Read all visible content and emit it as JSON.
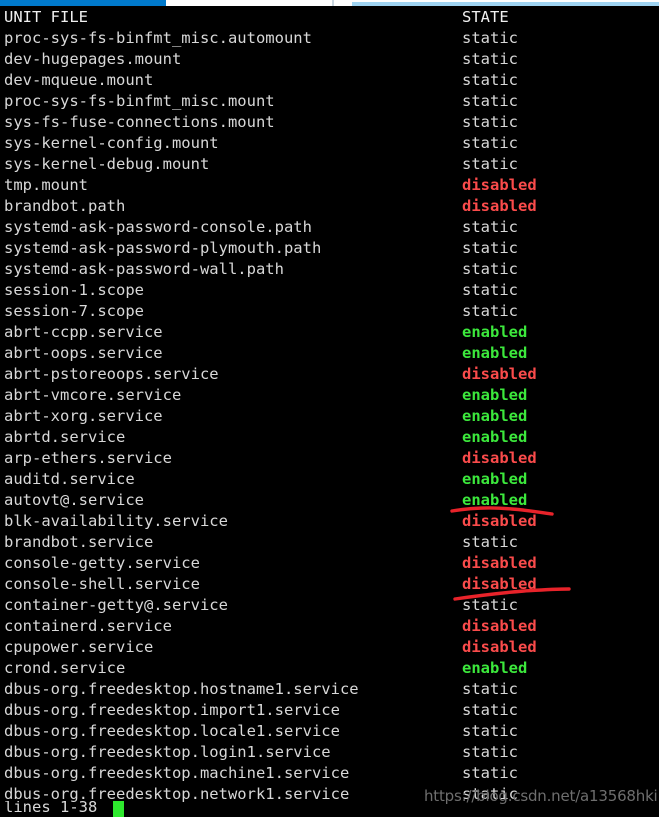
{
  "window": {
    "chrome_note": "partial browser/terminal tab strip"
  },
  "pager": {
    "columns": {
      "unit_file": "UNIT FILE",
      "state": "STATE"
    },
    "rows": [
      {
        "unit": "proc-sys-fs-binfmt_misc.automount",
        "state": "static"
      },
      {
        "unit": "dev-hugepages.mount",
        "state": "static"
      },
      {
        "unit": "dev-mqueue.mount",
        "state": "static"
      },
      {
        "unit": "proc-sys-fs-binfmt_misc.mount",
        "state": "static"
      },
      {
        "unit": "sys-fs-fuse-connections.mount",
        "state": "static"
      },
      {
        "unit": "sys-kernel-config.mount",
        "state": "static"
      },
      {
        "unit": "sys-kernel-debug.mount",
        "state": "static"
      },
      {
        "unit": "tmp.mount",
        "state": "disabled"
      },
      {
        "unit": "brandbot.path",
        "state": "disabled"
      },
      {
        "unit": "systemd-ask-password-console.path",
        "state": "static"
      },
      {
        "unit": "systemd-ask-password-plymouth.path",
        "state": "static"
      },
      {
        "unit": "systemd-ask-password-wall.path",
        "state": "static"
      },
      {
        "unit": "session-1.scope",
        "state": "static"
      },
      {
        "unit": "session-7.scope",
        "state": "static"
      },
      {
        "unit": "abrt-ccpp.service",
        "state": "enabled"
      },
      {
        "unit": "abrt-oops.service",
        "state": "enabled"
      },
      {
        "unit": "abrt-pstoreoops.service",
        "state": "disabled"
      },
      {
        "unit": "abrt-vmcore.service",
        "state": "enabled"
      },
      {
        "unit": "abrt-xorg.service",
        "state": "enabled"
      },
      {
        "unit": "abrtd.service",
        "state": "enabled"
      },
      {
        "unit": "arp-ethers.service",
        "state": "disabled"
      },
      {
        "unit": "auditd.service",
        "state": "enabled"
      },
      {
        "unit": "autovt@.service",
        "state": "enabled"
      },
      {
        "unit": "blk-availability.service",
        "state": "disabled"
      },
      {
        "unit": "brandbot.service",
        "state": "static"
      },
      {
        "unit": "console-getty.service",
        "state": "disabled"
      },
      {
        "unit": "console-shell.service",
        "state": "disabled"
      },
      {
        "unit": "container-getty@.service",
        "state": "static"
      },
      {
        "unit": "containerd.service",
        "state": "disabled"
      },
      {
        "unit": "cpupower.service",
        "state": "disabled"
      },
      {
        "unit": "crond.service",
        "state": "enabled"
      },
      {
        "unit": "dbus-org.freedesktop.hostname1.service",
        "state": "static"
      },
      {
        "unit": "dbus-org.freedesktop.import1.service",
        "state": "static"
      },
      {
        "unit": "dbus-org.freedesktop.locale1.service",
        "state": "static"
      },
      {
        "unit": "dbus-org.freedesktop.login1.service",
        "state": "static"
      },
      {
        "unit": "dbus-org.freedesktop.machine1.service",
        "state": "static"
      },
      {
        "unit": "dbus-org.freedesktop.network1.service",
        "state": "static"
      }
    ]
  },
  "status_bar": {
    "text": "lines 1-38"
  },
  "annotations": [
    {
      "id": "underline-autovt-enabled",
      "target_row": 22,
      "color": "#e8232a"
    },
    {
      "id": "underline-console-shell-disabled",
      "target_row": 26,
      "color": "#e8232a"
    }
  ],
  "watermark": {
    "text": "https://blog.csdn.net/a13568hki"
  },
  "colors": {
    "background": "#000000",
    "foreground": "#d8d8d8",
    "enabled": "#3ce83c",
    "disabled": "#fa4b4b",
    "cursor": "#2ee82e",
    "annotation_red": "#e8232a",
    "chrome_blue": "#0079cc",
    "watermark_grey": "#6e6e6e"
  }
}
